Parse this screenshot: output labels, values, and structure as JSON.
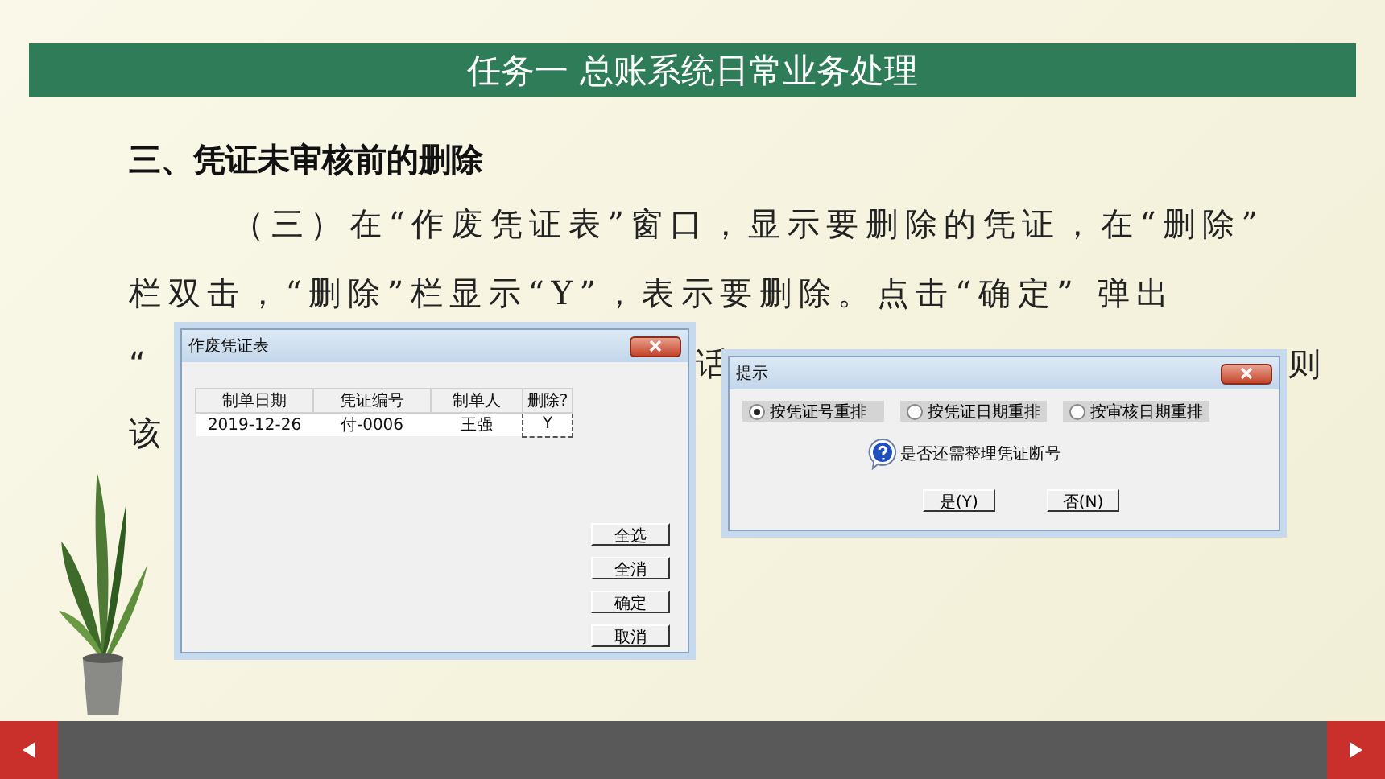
{
  "slide_title": "任务一 总账系统日常业务处理",
  "heading": "三、凭证未审核前的删除",
  "paragraph_lines": [
    {
      "segments": [
        "（三）在“作废凭证表”窗口，显示要删除的凭证，在“删除”"
      ]
    },
    {
      "segments": [
        "栏双击，“删除”栏显示“Y”，表示要删除。点击“确定” 弹出"
      ]
    },
    {
      "segments": [
        "“",
        "话",
        "则"
      ]
    },
    {
      "segments": [
        "该"
      ]
    }
  ],
  "void_dialog": {
    "title": "作废凭证表",
    "columns": [
      "制单日期",
      "凭证编号",
      "制单人",
      "删除?"
    ],
    "rows": [
      [
        "2019-12-26",
        "付-0006",
        "王强",
        "Y"
      ]
    ],
    "buttons": [
      "全选",
      "全消",
      "确定",
      "取消"
    ]
  },
  "prompt_dialog": {
    "title": "提示",
    "options": [
      {
        "label": "按凭证号重排",
        "selected": true
      },
      {
        "label": "按凭证日期重排",
        "selected": false
      },
      {
        "label": "按审核日期重排",
        "selected": false
      }
    ],
    "message": "是否还需整理凭证断号",
    "buttons": [
      "是(Y)",
      "否(N)"
    ]
  }
}
